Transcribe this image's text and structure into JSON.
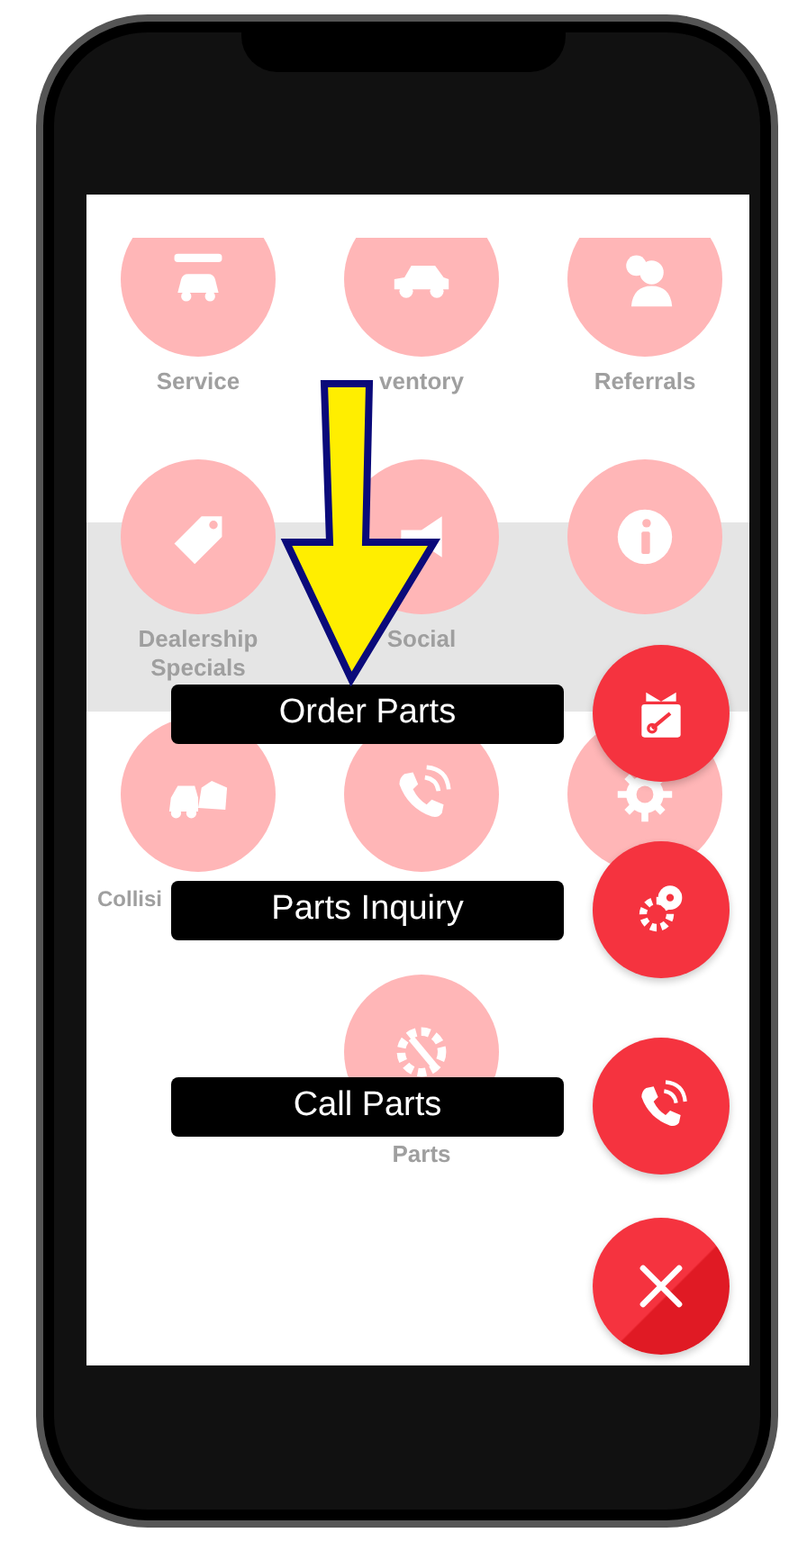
{
  "menu_grid": {
    "rows": [
      [
        "Service",
        "ventory",
        "Referrals"
      ],
      [
        "Dealership Specials",
        "Social",
        ""
      ],
      [
        "Collisi",
        "",
        ""
      ],
      [
        "",
        "Parts",
        ""
      ]
    ]
  },
  "speed_dial": {
    "actions": [
      {
        "label": "Order Parts"
      },
      {
        "label": "Parts Inquiry"
      },
      {
        "label": "Call Parts"
      }
    ]
  }
}
